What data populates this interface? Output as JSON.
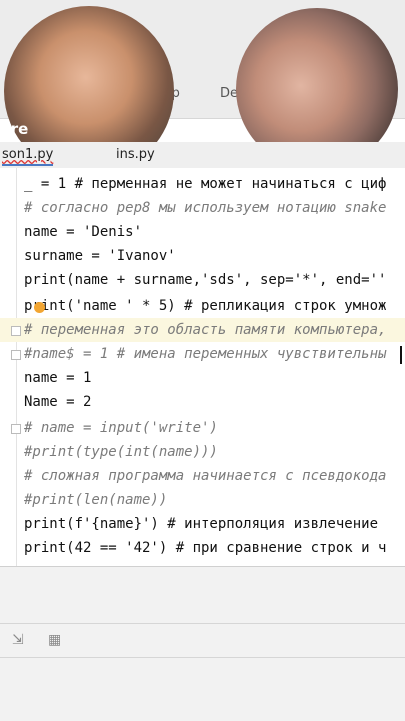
{
  "menu": {
    "help": "elp",
    "partial": "De"
  },
  "user_label": "dre",
  "tabs": [
    {
      "label": "son1.py",
      "active": true
    },
    {
      "label": "ins.py",
      "active": false
    }
  ],
  "code_lines": [
    "_ = 1 # перменная не может начинаться с циф",
    "# согласно pep8 мы используем нотацию snake",
    "name = 'Denis'",
    "surname = 'Ivanov'",
    "print(name + surname,'sds', sep='*', end=''",
    "print('name ' * 5) # репликация строк умнож",
    "# переменная это область памяти компьютера,",
    "#name$ = 1 # имена переменных чувствительны",
    "name = 1",
    "Name = 2",
    "# name = input('write')",
    "#print(type(int(name)))",
    "# сложная программа начинается с псевдокода",
    "#print(len(name))",
    "print(f'{name}') # интерполяция извлечение",
    "print(42 == '42') # при сравнение строк и ч"
  ],
  "colors": {
    "accent": "#4a78c2",
    "keyword": "#1f2aa8",
    "string": "#127a12",
    "number": "#1d33d6",
    "comment": "#7b7b7b"
  },
  "icons": {
    "bulb": "lightbulb-icon",
    "fold": "fold-marker-icon",
    "panel_left": "run-icon",
    "panel_right": "grid-icon"
  }
}
